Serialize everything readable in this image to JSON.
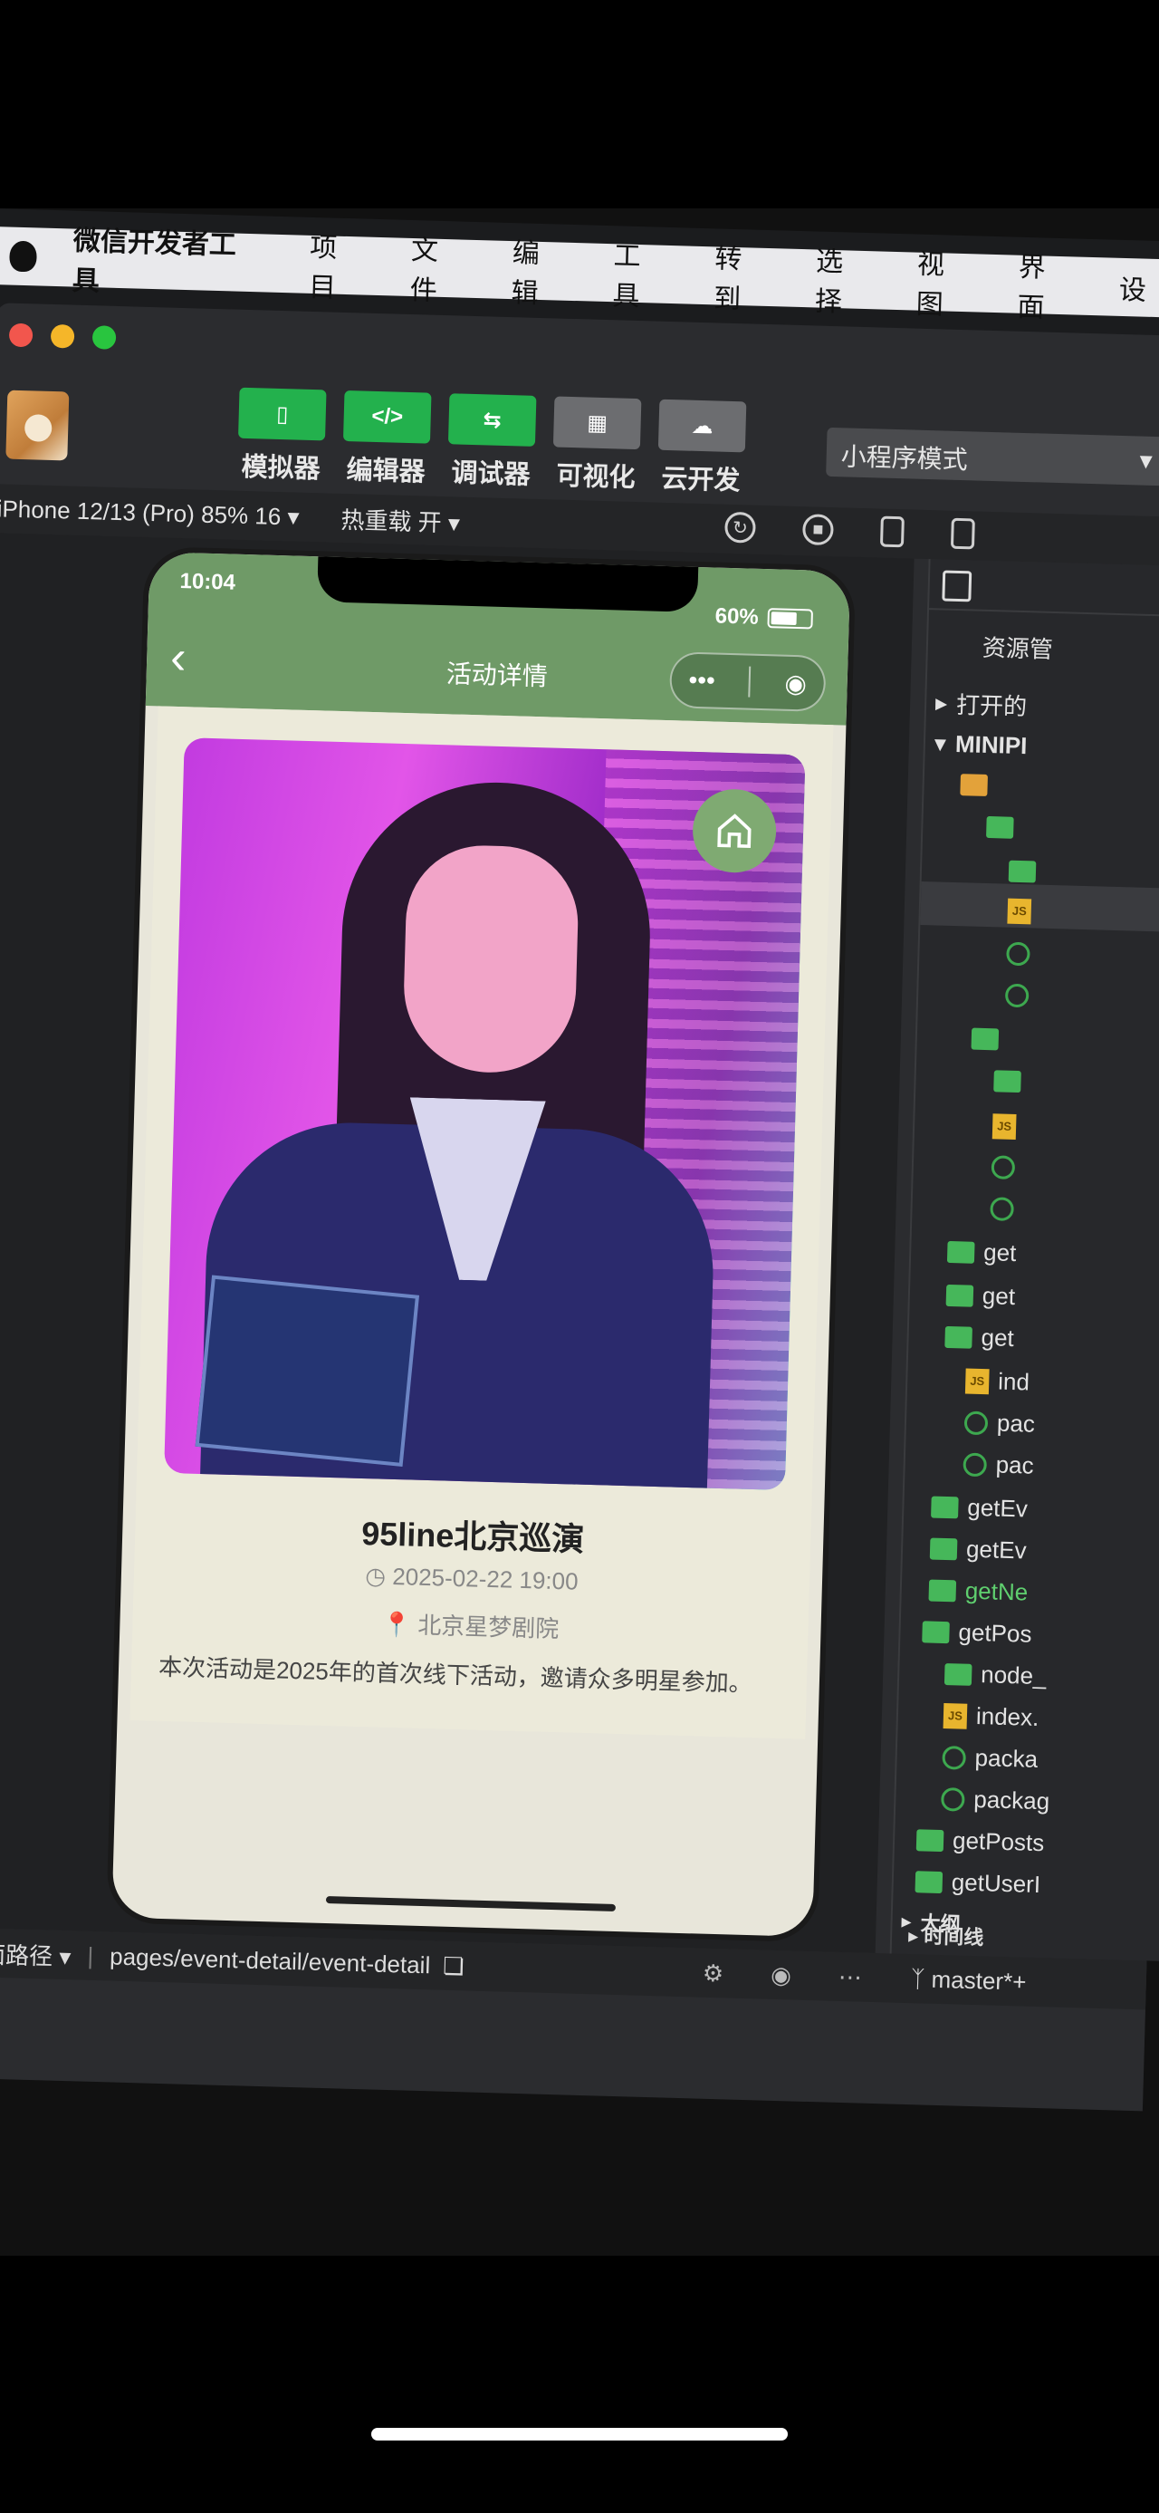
{
  "menubar": {
    "app_name": "微信开发者工具",
    "items": [
      "项目",
      "文件",
      "编辑",
      "工具",
      "转到",
      "选择",
      "视图",
      "界面",
      "设"
    ]
  },
  "toolbar": {
    "buttons": [
      {
        "label": "模拟器",
        "icon": "phone-icon"
      },
      {
        "label": "编辑器",
        "icon": "code-icon"
      },
      {
        "label": "调试器",
        "icon": "debug-icon"
      },
      {
        "label": "可视化",
        "icon": "layout-icon"
      },
      {
        "label": "云开发",
        "icon": "cloud-icon"
      }
    ],
    "mode": "小程序模式"
  },
  "subbar": {
    "device": "iPhone 12/13 (Pro) 85% 16",
    "hot_reload": "热重载 开"
  },
  "simulator": {
    "time": "10:04",
    "battery": "60%",
    "battery_level": 0.6,
    "nav_title": "活动详情",
    "event": {
      "title": "95line北京巡演",
      "time": "2025-02-22 19:00",
      "location": "北京星梦剧院",
      "description": "本次活动是2025年的首次线下活动，邀请众多明星参加。"
    }
  },
  "pathbar": {
    "label": "页面路径",
    "path": "pages/event-detail/event-detail"
  },
  "tree": {
    "title": "资源管",
    "open_label": "打开的",
    "project": "MINIPI",
    "items": [
      "get",
      "get",
      "get",
      "ind",
      "pac",
      "pac",
      "getEv",
      "getEv",
      "getNe",
      "getPos",
      "node_",
      "index.",
      "packa",
      "packag",
      "getPosts",
      "getUserI"
    ],
    "outline": "大纲",
    "timeline": "时间线",
    "branch": "master*+"
  },
  "colors": {
    "nav_green": "#6f9a67",
    "tool_green": "#23b14d",
    "page_bg": "#eceada"
  }
}
